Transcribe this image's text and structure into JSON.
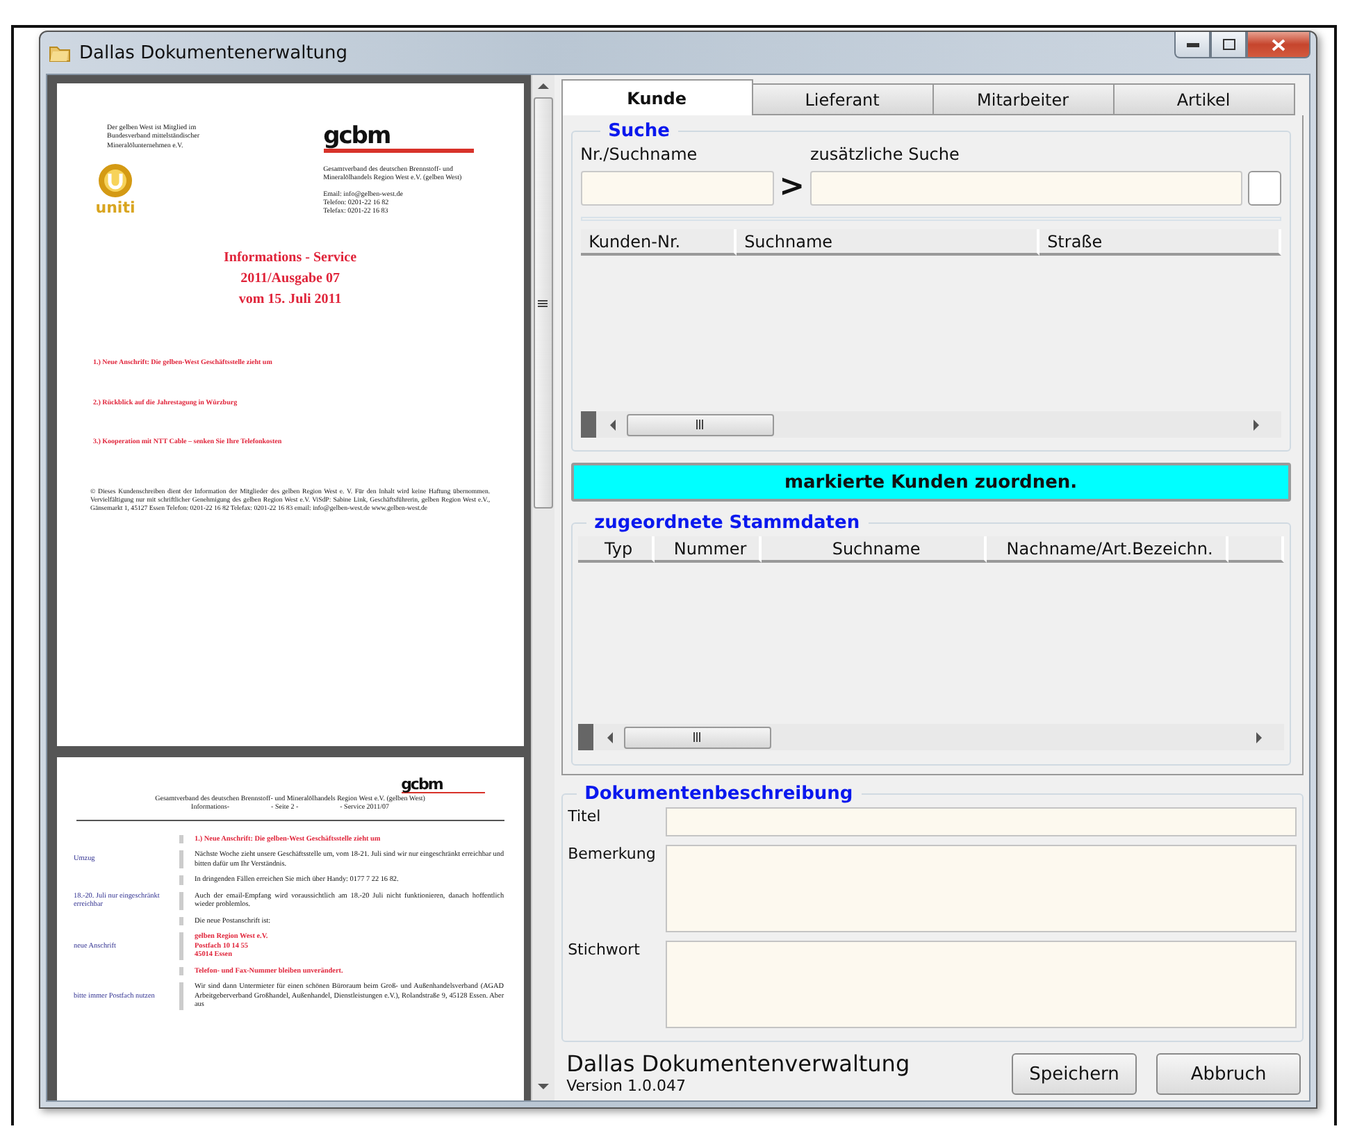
{
  "window": {
    "title": "Dallas Dokumentenerwaltung"
  },
  "document_preview": {
    "pages": [
      {
        "kind": "cover",
        "member_note": "Der gelben West ist Mitglied im Bundesverband mittelständischer Mineralölunternehmen e.V.",
        "member_logo": "uniti",
        "org_logo": "gcbm",
        "org_address": "Gesamtverband des deutschen Brennstoff- und Mineralölhandels Region West e.V. (gelben West)",
        "contact": [
          "Email: info@gelben-west.de",
          "Telefon: 0201-22 16 82",
          "Telefax: 0201-22 16 83"
        ],
        "heading": [
          "Informations - Service",
          "2011/Ausgabe 07",
          "vom 15. Juli 2011"
        ],
        "topics": [
          "1.) Neue Anschrift: Die gelben-West Geschäftsstelle zieht um",
          "2.) Rückblick auf die Jahrestagung in Würzburg",
          "3.) Kooperation mit NTT Cable – senken Sie Ihre Telefonkosten"
        ],
        "footer_note": "© Dieses Kundenschreiben dient der Information der Mitglieder des gelben Region West e. V. Für den Inhalt wird keine Haftung übernommen. Vervielfältigung nur mit schriftlicher Genehmigung des gelben Region West e.V. ViSdP: Sabine Link, Geschäftsführerin, gelben Region West e.V., Gänsemarkt 1, 45127 Essen Telefon: 0201-22 16 82 Telefax: 0201-22 16 83 email: info@gelben-west.de www.gelben-west.de"
      },
      {
        "kind": "inner",
        "org_logo": "gcbm",
        "org_line": "Gesamtverband des deutschen Brennstoff- und Mineralölhandels Region West e.V. (gelben West)",
        "header_parts": [
          "Informations-",
          "- Seite 2 -",
          "- Service 2011/07"
        ],
        "blocks": [
          {
            "kind": "heading",
            "text": "1.) Neue Anschrift: Die gelben-West Geschäftsstelle zieht um"
          },
          {
            "kind": "body",
            "text": "Nächste Woche zieht unsere Geschäftsstelle um, vom 18-21. Juli sind wir nur eingeschränkt erreichbar und bitten dafür um Ihr Verständnis.",
            "note": "Umzug"
          },
          {
            "kind": "body",
            "text": "In dringenden Fällen erreichen Sie mich über Handy: 0177 7 22 16 82."
          },
          {
            "kind": "body",
            "text": "Auch der email-Empfang wird voraussichtlich am 18.-20 Juli nicht funktionieren, danach hoffentlich wieder problemlos.",
            "note": "18.-20. Juli nur eingeschränkt erreichbar"
          },
          {
            "kind": "body",
            "text": "Die neue Postanschrift ist:"
          },
          {
            "kind": "address",
            "lines": [
              "gelben Region West e.V.",
              "Postfach 10 14 55",
              "45014 Essen"
            ],
            "note": "neue Anschrift"
          },
          {
            "kind": "heading",
            "text": "Telefon- und Fax-Nummer bleiben unverändert."
          },
          {
            "kind": "body",
            "text": "Wir sind dann Untermieter für einen schönen Büroraum beim Groß- und Außenhandelsverband (AGAD Arbeitgeberverband Großhandel, Außenhandel, Dienstleistungen e.V.), Rolandstraße 9, 45128 Essen. Aber aus",
            "note": "bitte immer Postfach nutzen"
          }
        ]
      }
    ]
  },
  "tabs": [
    {
      "label": "Kunde",
      "selected": true
    },
    {
      "label": "Lieferant",
      "selected": false
    },
    {
      "label": "Mitarbeiter",
      "selected": false
    },
    {
      "label": "Artikel",
      "selected": false
    }
  ],
  "search": {
    "title": "Suche",
    "fields": [
      {
        "label": "Nr./Suchname"
      },
      {
        "label": "zusätzliche Suche"
      }
    ],
    "separator": ">",
    "table": {
      "columns": [
        "Kunden-Nr.",
        "Suchname",
        "Straße"
      ]
    }
  },
  "assign_button": "markierte Kunden zuordnen.",
  "assigned": {
    "title": "zugeordnete Stammdaten",
    "columns": [
      "Typ",
      "Nummer",
      "Suchname",
      "Nachname/Art.Bezeichn."
    ]
  },
  "description": {
    "title": "Dokumentenbeschreibung",
    "fields": [
      {
        "label": "Titel",
        "kind": "line"
      },
      {
        "label": "Bemerkung",
        "kind": "area"
      },
      {
        "label": "Stichwort",
        "kind": "area"
      }
    ]
  },
  "footer": {
    "app_name": "Dallas Dokumentenverwaltung",
    "version": "Version 1.0.047",
    "buttons": [
      "Speichern",
      "Abbruch"
    ]
  }
}
